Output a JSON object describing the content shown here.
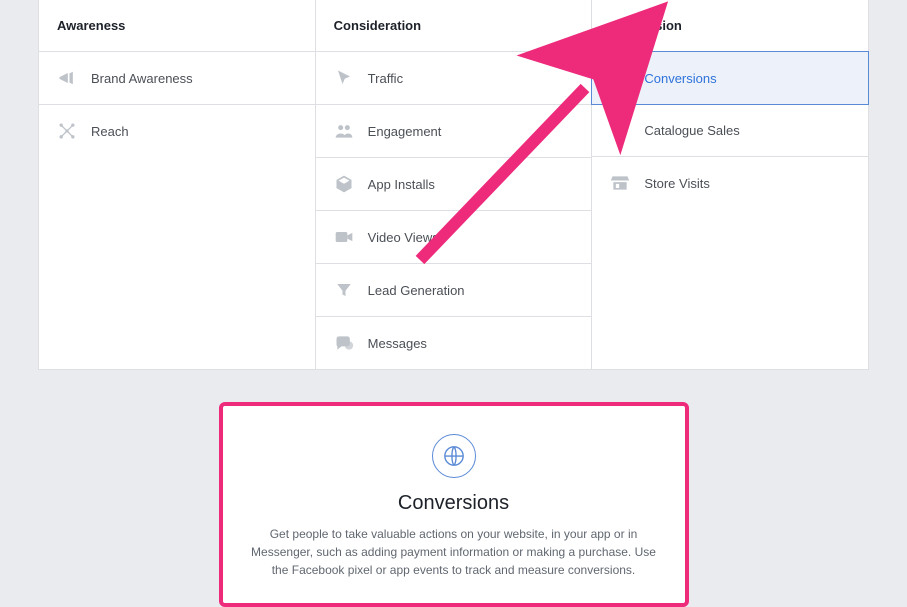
{
  "columns": {
    "awareness": {
      "header": "Awareness",
      "items": [
        {
          "label": "Brand Awareness",
          "icon": "megaphone-icon"
        },
        {
          "label": "Reach",
          "icon": "spread-icon"
        }
      ]
    },
    "consideration": {
      "header": "Consideration",
      "items": [
        {
          "label": "Traffic",
          "icon": "cursor-icon"
        },
        {
          "label": "Engagement",
          "icon": "people-icon"
        },
        {
          "label": "App Installs",
          "icon": "box-icon"
        },
        {
          "label": "Video Views",
          "icon": "video-icon"
        },
        {
          "label": "Lead Generation",
          "icon": "funnel-icon"
        },
        {
          "label": "Messages",
          "icon": "chat-icon"
        }
      ]
    },
    "conversion": {
      "header": "Conversion",
      "items": [
        {
          "label": "Conversions",
          "icon": "check-circle-icon",
          "selected": true
        },
        {
          "label": "Catalogue Sales",
          "icon": "tag-icon"
        },
        {
          "label": "Store Visits",
          "icon": "store-icon"
        }
      ]
    }
  },
  "detail": {
    "title": "Conversions",
    "description": "Get people to take valuable actions on your website, in your app or in Messenger, such as adding payment information or making a purchase. Use the Facebook pixel or app events to track and measure conversions."
  },
  "annotations": {
    "highlight_color": "#ee2a7b"
  }
}
